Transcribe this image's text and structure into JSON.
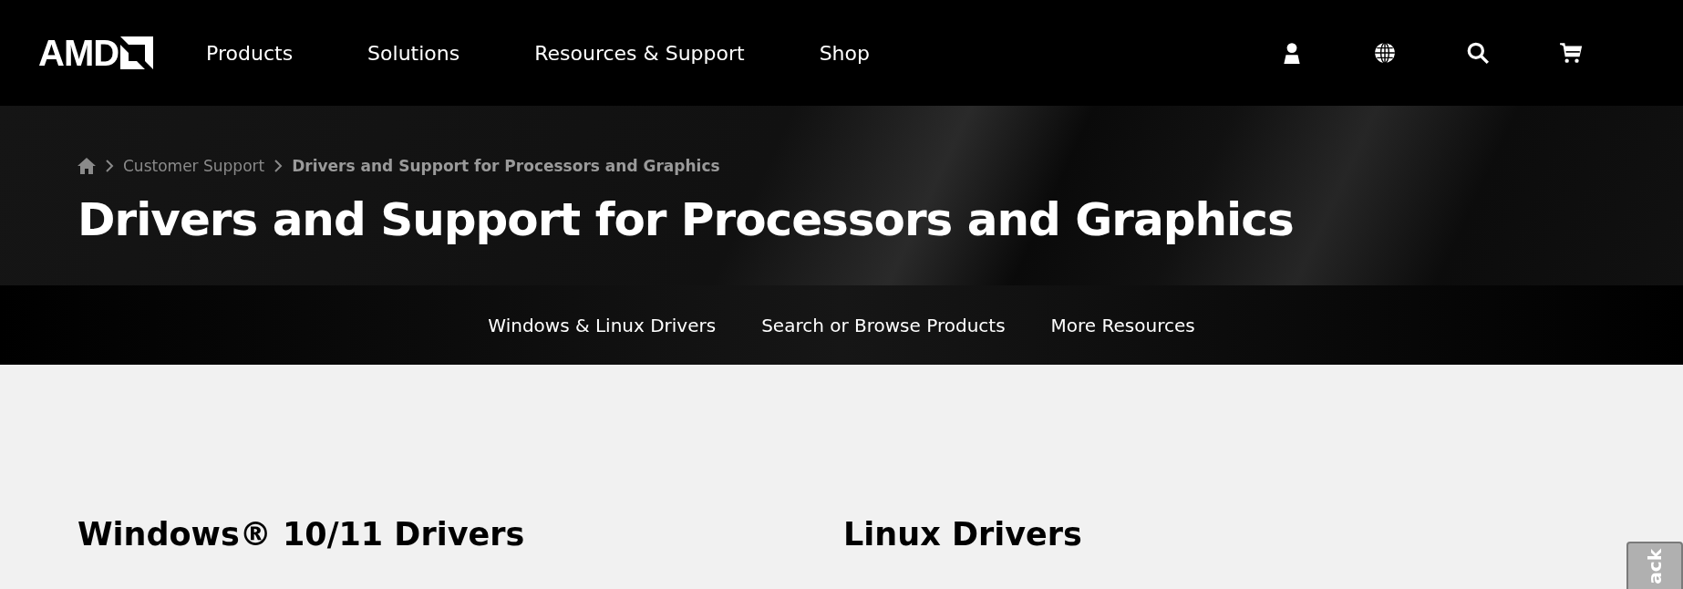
{
  "header": {
    "logo": "AMD",
    "nav": [
      "Products",
      "Solutions",
      "Resources & Support",
      "Shop"
    ]
  },
  "breadcrumb": [
    "Customer Support",
    "Drivers and Support for Processors and Graphics"
  ],
  "title": "Drivers and Support for Processors and Graphics",
  "subnav": [
    "Windows & Linux Drivers",
    "Search or Browse Products",
    "More Resources"
  ],
  "sections": [
    "Windows® 10/11 Drivers",
    "Linux Drivers"
  ],
  "side_tab": "ack"
}
